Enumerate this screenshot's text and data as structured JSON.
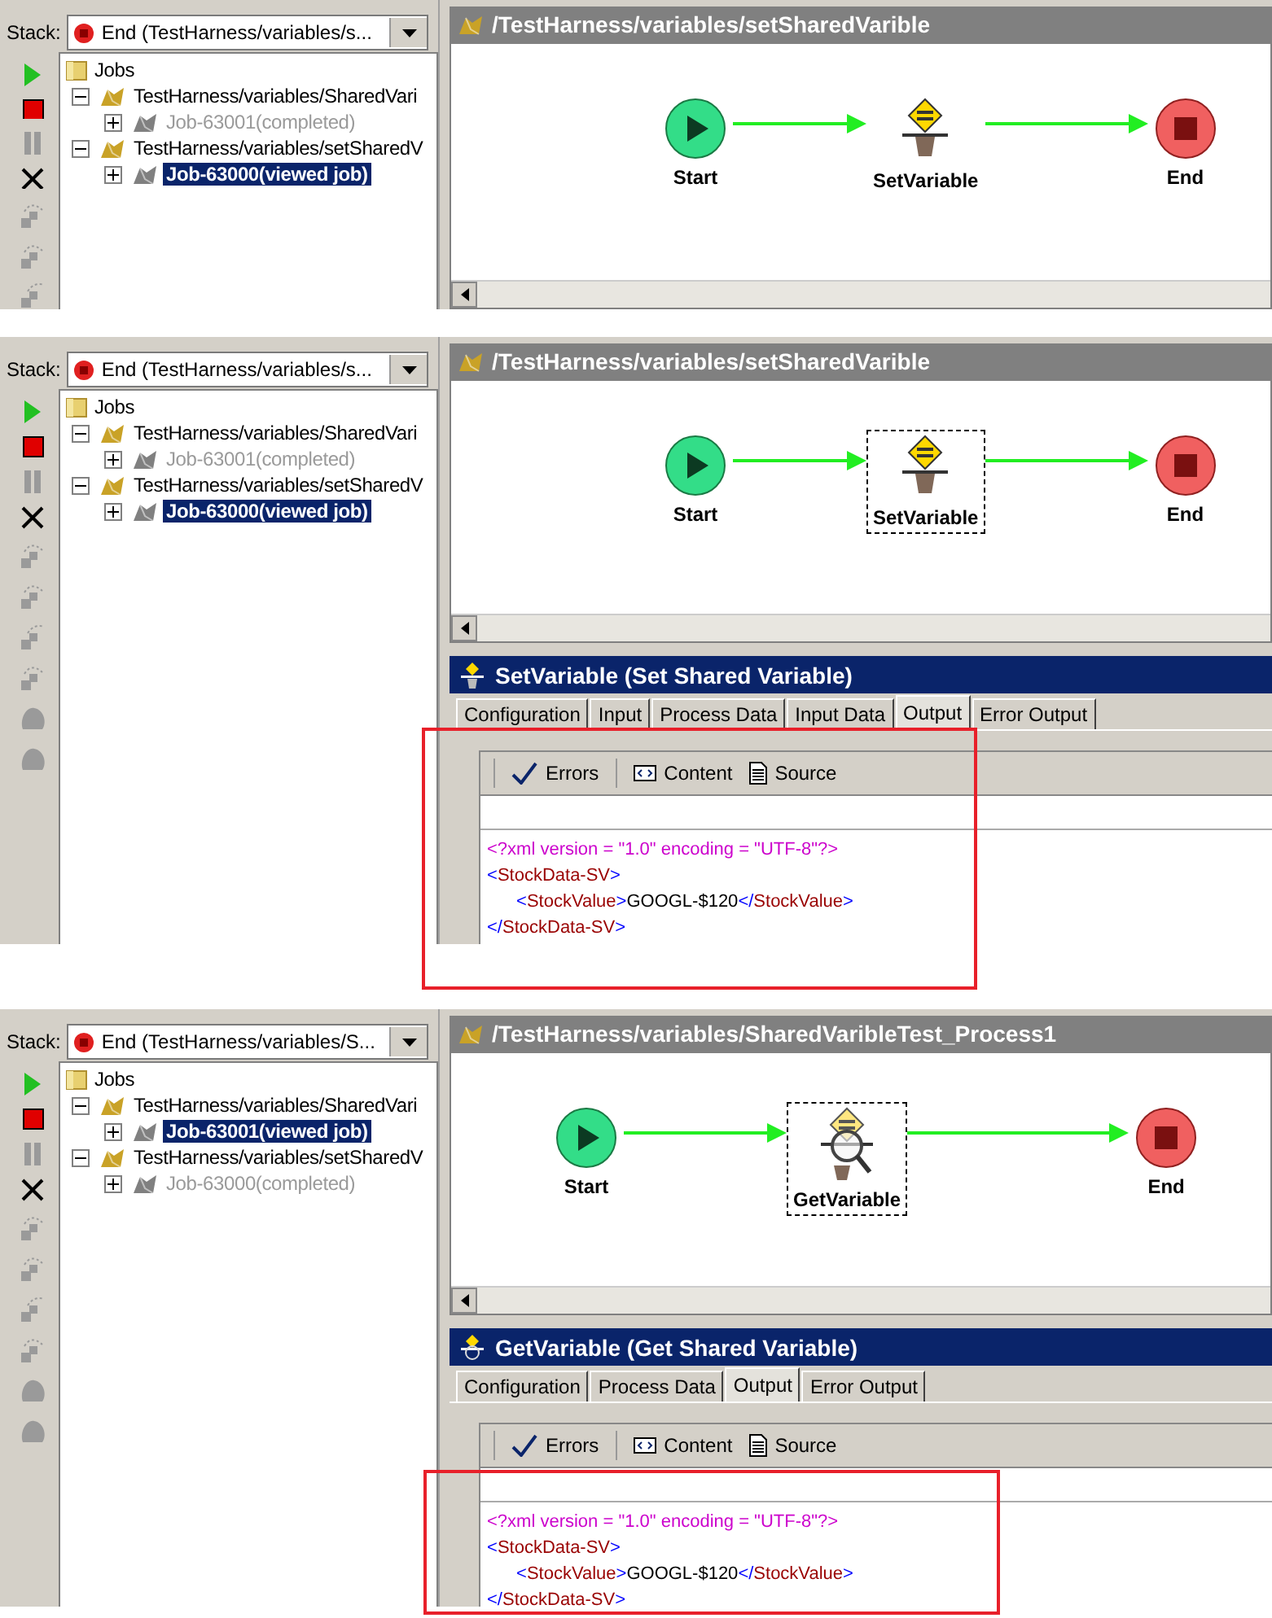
{
  "panels": [
    {
      "stack_label": "Stack:",
      "stack_value": "End (TestHarness/variables/s...",
      "toolbar": [
        {
          "kind": "run",
          "disabled": false
        },
        {
          "kind": "stop",
          "disabled": false
        },
        {
          "kind": "pause",
          "disabled": true
        },
        {
          "kind": "cancel",
          "disabled": false
        },
        {
          "kind": "step-over",
          "disabled": true
        },
        {
          "kind": "step-into",
          "disabled": true
        },
        {
          "kind": "step-out",
          "disabled": true
        }
      ],
      "tree": {
        "label": "Jobs",
        "children": [
          {
            "label": "TestHarness/variables/SharedVari",
            "expanded": true,
            "children": [
              {
                "label": "Job-63001(completed)",
                "expanded": false,
                "selected": false,
                "disabled": true
              }
            ]
          },
          {
            "label": "TestHarness/variables/setSharedV",
            "expanded": true,
            "children": [
              {
                "label": "Job-63000(viewed job)",
                "expanded": false,
                "selected": true,
                "disabled": false
              }
            ]
          }
        ]
      },
      "process_title": "/TestHarness/variables/setSharedVarible",
      "nodes": [
        {
          "label": "Start",
          "kind": "start",
          "selected": false
        },
        {
          "label": "SetVariable",
          "kind": "set",
          "selected": false
        },
        {
          "label": "End",
          "kind": "end",
          "selected": false
        }
      ]
    },
    {
      "stack_label": "Stack:",
      "stack_value": "End (TestHarness/variables/s...",
      "toolbar": [
        {
          "kind": "run",
          "disabled": false
        },
        {
          "kind": "stop",
          "disabled": false
        },
        {
          "kind": "pause",
          "disabled": true
        },
        {
          "kind": "cancel",
          "disabled": false
        },
        {
          "kind": "step-over",
          "disabled": true
        },
        {
          "kind": "step-into",
          "disabled": true
        },
        {
          "kind": "step-out",
          "disabled": true
        },
        {
          "kind": "step-next",
          "disabled": true
        },
        {
          "kind": "blob",
          "disabled": true
        },
        {
          "kind": "blob",
          "disabled": true
        }
      ],
      "tree": {
        "label": "Jobs",
        "children": [
          {
            "label": "TestHarness/variables/SharedVari",
            "expanded": true,
            "children": [
              {
                "label": "Job-63001(completed)",
                "expanded": false,
                "selected": false,
                "disabled": true
              }
            ]
          },
          {
            "label": "TestHarness/variables/setSharedV",
            "expanded": true,
            "children": [
              {
                "label": "Job-63000(viewed job)",
                "expanded": false,
                "selected": true,
                "disabled": false
              }
            ]
          }
        ]
      },
      "process_title": "/TestHarness/variables/setSharedVarible",
      "nodes": [
        {
          "label": "Start",
          "kind": "start",
          "selected": false
        },
        {
          "label": "SetVariable",
          "kind": "set",
          "selected": true
        },
        {
          "label": "End",
          "kind": "end",
          "selected": false
        }
      ],
      "details": {
        "title": "SetVariable (Set Shared Variable)",
        "kind": "set",
        "highlight": true,
        "tabs": [
          {
            "label": "Configuration",
            "selected": false
          },
          {
            "label": "Input",
            "selected": false
          },
          {
            "label": "Process Data",
            "selected": false
          },
          {
            "label": "Input Data",
            "selected": false
          },
          {
            "label": "Output",
            "selected": true
          },
          {
            "label": "Error Output",
            "selected": false
          }
        ],
        "tools": [
          {
            "label": "Errors",
            "kind": "check"
          },
          {
            "label": "Content",
            "kind": "content"
          },
          {
            "label": "Source",
            "kind": "source"
          }
        ],
        "xml": [
          {
            "indented": false,
            "tokens": [
              {
                "kind": "decl",
                "text": "<?xml version = \"1.0\" encoding = \"UTF-8\"?>"
              }
            ]
          },
          {
            "indented": false,
            "tokens": [
              {
                "kind": "punct",
                "text": "<"
              },
              {
                "kind": "tag",
                "text": "StockData-SV"
              },
              {
                "kind": "punct",
                "text": ">"
              }
            ]
          },
          {
            "indented": true,
            "tokens": [
              {
                "kind": "punct",
                "text": "<"
              },
              {
                "kind": "tag",
                "text": "StockValue"
              },
              {
                "kind": "punct",
                "text": ">"
              },
              {
                "kind": "value",
                "text": "GOOGL-$120"
              },
              {
                "kind": "punct",
                "text": "</"
              },
              {
                "kind": "tag",
                "text": "StockValue"
              },
              {
                "kind": "punct",
                "text": ">"
              }
            ]
          },
          {
            "indented": false,
            "tokens": [
              {
                "kind": "punct",
                "text": "</"
              },
              {
                "kind": "tag",
                "text": "StockData-SV"
              },
              {
                "kind": "punct",
                "text": ">"
              }
            ]
          }
        ]
      }
    },
    {
      "stack_label": "Stack:",
      "stack_value": "End (TestHarness/variables/S...",
      "toolbar": [
        {
          "kind": "run",
          "disabled": false
        },
        {
          "kind": "stop",
          "disabled": false
        },
        {
          "kind": "pause",
          "disabled": true
        },
        {
          "kind": "cancel",
          "disabled": false
        },
        {
          "kind": "step-over",
          "disabled": true
        },
        {
          "kind": "step-into",
          "disabled": true
        },
        {
          "kind": "step-out",
          "disabled": true
        },
        {
          "kind": "step-next",
          "disabled": true
        },
        {
          "kind": "blob",
          "disabled": true
        },
        {
          "kind": "blob",
          "disabled": true
        }
      ],
      "tree": {
        "label": "Jobs",
        "children": [
          {
            "label": "TestHarness/variables/SharedVari",
            "expanded": true,
            "children": [
              {
                "label": "Job-63001(viewed job)",
                "expanded": false,
                "selected": true,
                "disabled": false
              }
            ]
          },
          {
            "label": "TestHarness/variables/setSharedV",
            "expanded": true,
            "children": [
              {
                "label": "Job-63000(completed)",
                "expanded": false,
                "selected": false,
                "disabled": true
              }
            ]
          }
        ]
      },
      "process_title": "/TestHarness/variables/SharedVaribleTest_Process1",
      "nodes": [
        {
          "label": "Start",
          "kind": "start",
          "selected": false
        },
        {
          "label": "GetVariable",
          "kind": "get",
          "selected": true
        },
        {
          "label": "End",
          "kind": "end",
          "selected": false
        }
      ],
      "details": {
        "title": "GetVariable (Get Shared Variable)",
        "kind": "get",
        "highlight": true,
        "tabs": [
          {
            "label": "Configuration",
            "selected": false
          },
          {
            "label": "Process Data",
            "selected": false
          },
          {
            "label": "Output",
            "selected": true
          },
          {
            "label": "Error Output",
            "selected": false
          }
        ],
        "tools": [
          {
            "label": "Errors",
            "kind": "check"
          },
          {
            "label": "Content",
            "kind": "content"
          },
          {
            "label": "Source",
            "kind": "source"
          }
        ],
        "xml": [
          {
            "indented": false,
            "tokens": [
              {
                "kind": "decl",
                "text": "<?xml version = \"1.0\" encoding = \"UTF-8\"?>"
              }
            ]
          },
          {
            "indented": false,
            "tokens": [
              {
                "kind": "punct",
                "text": "<"
              },
              {
                "kind": "tag",
                "text": "StockData-SV"
              },
              {
                "kind": "punct",
                "text": ">"
              }
            ]
          },
          {
            "indented": true,
            "tokens": [
              {
                "kind": "punct",
                "text": "<"
              },
              {
                "kind": "tag",
                "text": "StockValue"
              },
              {
                "kind": "punct",
                "text": ">"
              },
              {
                "kind": "value",
                "text": "GOOGL-$120"
              },
              {
                "kind": "punct",
                "text": "</"
              },
              {
                "kind": "tag",
                "text": "StockValue"
              },
              {
                "kind": "punct",
                "text": ">"
              }
            ]
          },
          {
            "indented": false,
            "tokens": [
              {
                "kind": "punct",
                "text": "</"
              },
              {
                "kind": "tag",
                "text": "StockData-SV"
              },
              {
                "kind": "punct",
                "text": ">"
              }
            ]
          }
        ]
      }
    }
  ]
}
